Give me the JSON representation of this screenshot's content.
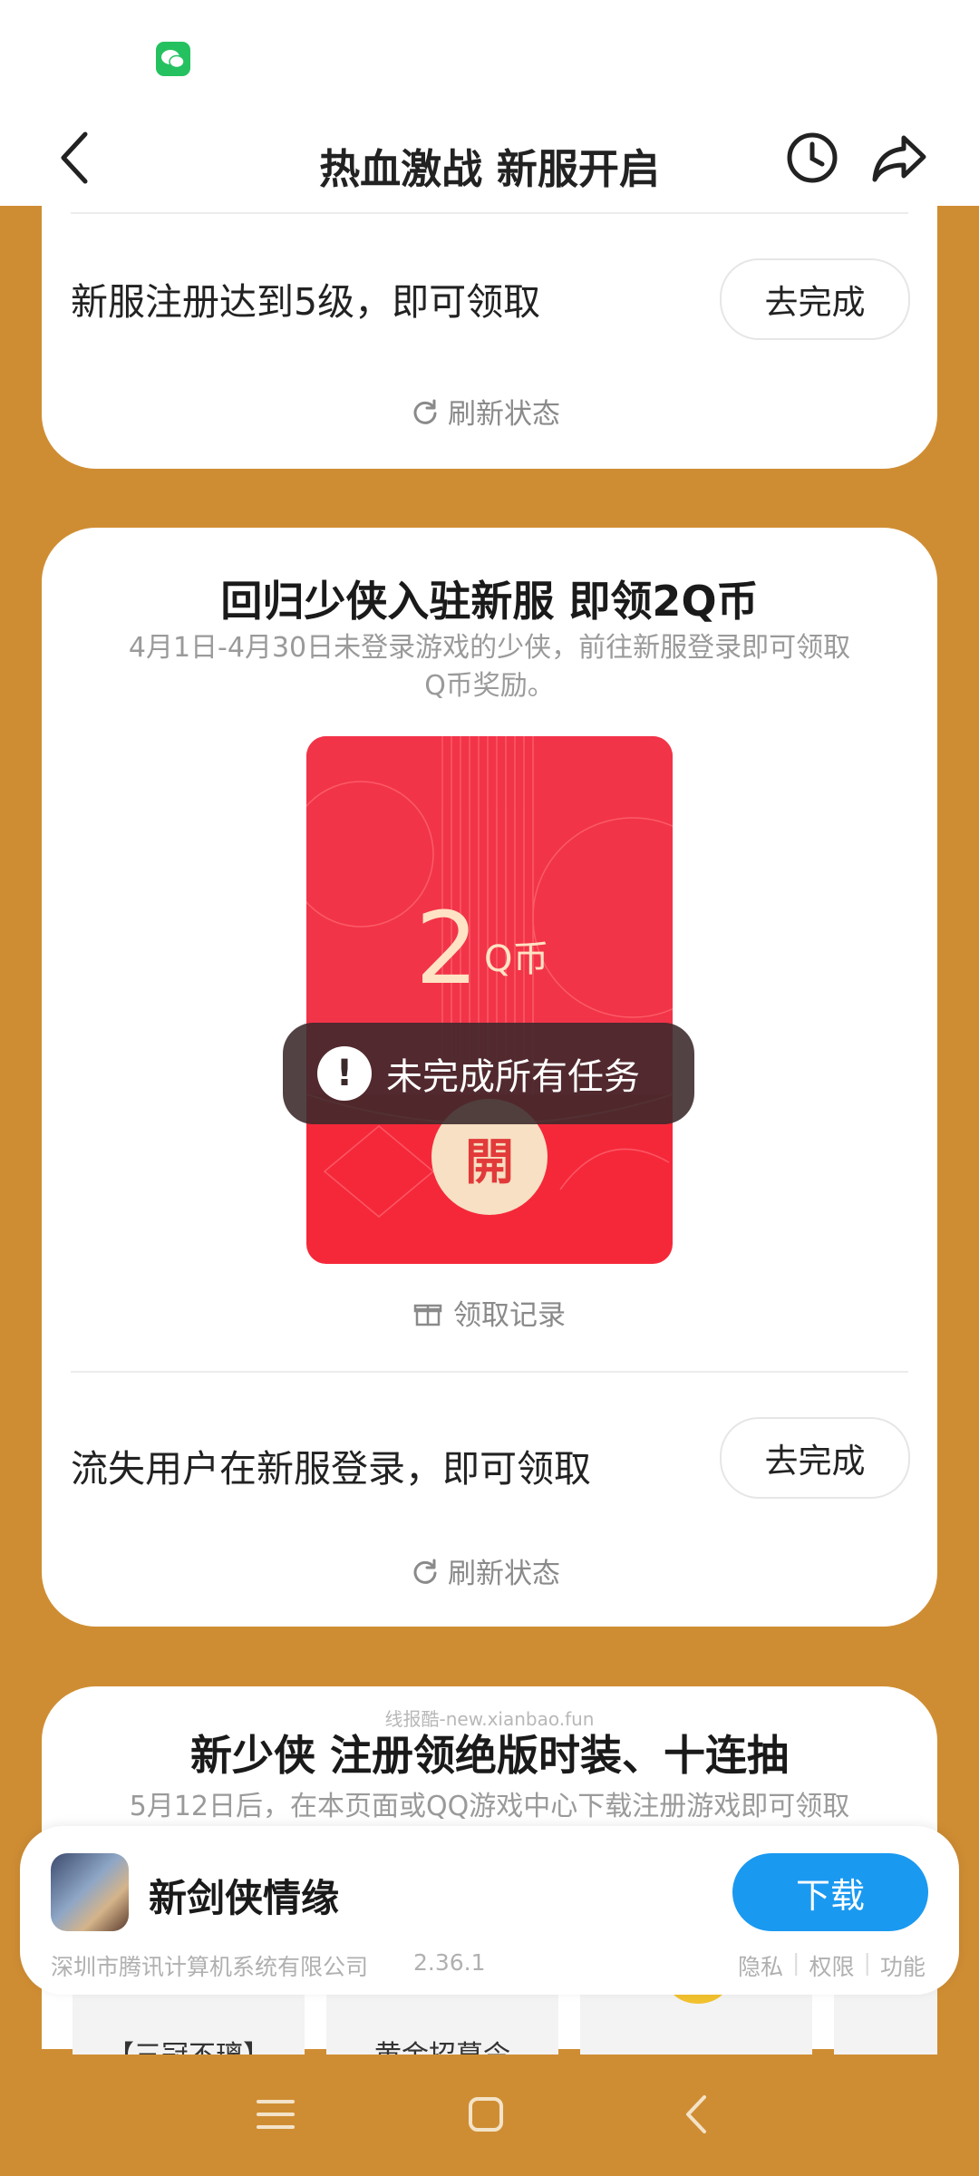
{
  "header": {
    "title": "热血激战 新服开启"
  },
  "task1": {
    "text": "新服注册达到5级，即可领取",
    "button": "去完成",
    "refresh": "刷新状态"
  },
  "section2": {
    "title": "回归少侠入驻新服 即领2Q币",
    "desc_line1": "4月1日-4月30日未登录游戏的少侠，前往新服登录即可领取",
    "desc_line2": "Q币奖励。",
    "packet": {
      "amount": "2",
      "unit": "Q币",
      "open": "開"
    },
    "records": "领取记录",
    "task_text": "流失用户在新服登录，即可领取",
    "task_button": "去完成",
    "refresh": "刷新状态"
  },
  "toast": {
    "icon": "!",
    "text": "未完成所有任务"
  },
  "section3": {
    "watermark": "线报酷-new.xianbao.fun",
    "title": "新少侠 注册领绝版时装、十连抽",
    "desc": "5月12日后，在本页面或QQ游戏中心下载注册游戏即可领取",
    "thumb_labels": [
      "【三冠不璃】",
      "黄金招募令"
    ]
  },
  "download_banner": {
    "app_name": "新剑侠情缘",
    "button": "下载",
    "company": "深圳市腾讯计算机系统有限公司",
    "version": "2.36.1",
    "links": [
      "隐私",
      "权限",
      "功能"
    ]
  },
  "colors": {
    "background": "#cf8d33",
    "packet_red": "#f5283a",
    "download_blue": "#1a99f0"
  },
  "icons": [
    "wechat-icon",
    "back-icon",
    "history-clock-icon",
    "share-icon",
    "refresh-icon",
    "gift-icon",
    "menu-icon",
    "home-icon",
    "nav-back-icon"
  ]
}
